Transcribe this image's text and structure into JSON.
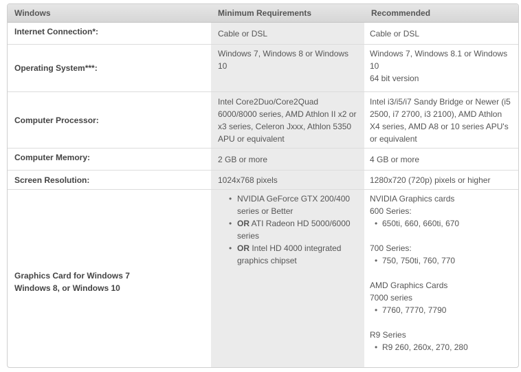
{
  "header": {
    "col1": "Windows",
    "col2": "Minimum Requirements",
    "col3": "Recommended"
  },
  "rows": {
    "internet": {
      "label": "Internet Connection*:",
      "min": "Cable or DSL",
      "rec": "Cable or DSL"
    },
    "os": {
      "label": "Operating System***:",
      "min": "Windows 7, Windows 8 or Windows 10",
      "rec": "Windows 7, Windows 8.1 or Windows 10",
      "rec_note": "64 bit version"
    },
    "cpu": {
      "label": "Computer Processor:",
      "min": "Intel Core2Duo/Core2Quad 6000/8000 series, AMD Athlon II x2 or x3 series, Celeron Jxxx, Athlon 5350 APU or equivalent",
      "rec": "Intel i3/i5/i7 Sandy Bridge or Newer (i5 2500, i7 2700, i3 2100), AMD Athlon X4 series, AMD A8 or 10 series APU's or equivalent"
    },
    "memory": {
      "label": "Computer Memory:",
      "min": "2 GB or more",
      "rec": "4 GB or more"
    },
    "resolution": {
      "label": "Screen Resolution:",
      "min": "1024x768 pixels",
      "rec": "1280x720 (720p) pixels or higher"
    },
    "gpu": {
      "label_line1": "Graphics Card for Windows 7",
      "label_line2": "Windows 8, or Windows 10",
      "min_items": [
        {
          "prefix": "",
          "text": "NVIDIA GeForce GTX 200/400 series or Better"
        },
        {
          "prefix": "OR",
          "text": " ATI Radeon HD 5000/6000 series"
        },
        {
          "prefix": "OR",
          "text": " Intel HD 4000 integrated graphics chipset"
        }
      ],
      "rec": {
        "nvidia_heading": "NVIDIA Graphics cards",
        "nvidia_600_heading": "600 Series:",
        "nvidia_600_models": "650ti, 660, 660ti, 670",
        "nvidia_700_heading": "700 Series:",
        "nvidia_700_models": "750, 750ti, 760, 770",
        "amd_heading": "AMD Graphics Cards",
        "amd_7000_heading": "7000 series",
        "amd_7000_models": "7760, 7770, 7790",
        "amd_r9_heading": "R9 Series",
        "amd_r9_models": "R9 260, 260x, 270, 280"
      }
    }
  }
}
